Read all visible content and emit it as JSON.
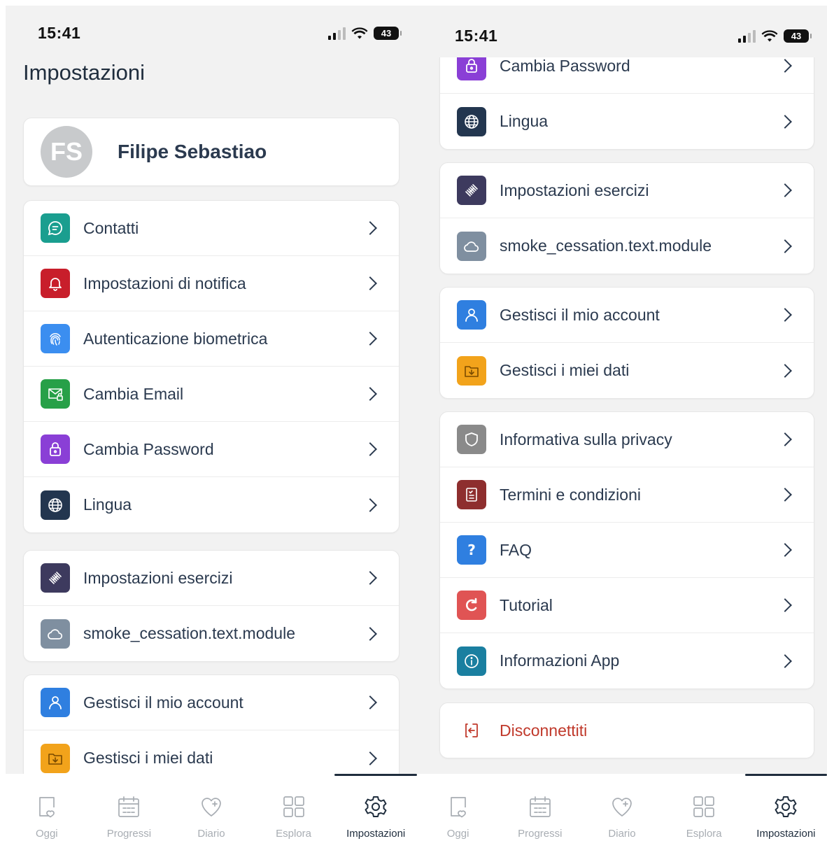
{
  "status": {
    "time": "15:41",
    "battery": "43"
  },
  "left": {
    "title": "Impostazioni",
    "profile": {
      "initials": "FS",
      "name": "Filipe Sebastiao"
    },
    "group1": [
      {
        "label": "Contatti",
        "icon": "chat-icon",
        "color": "#1a9e8f"
      },
      {
        "label": "Impostazioni di notifica",
        "icon": "bell-icon",
        "color": "#c81e2b"
      },
      {
        "label": "Autenticazione biometrica",
        "icon": "fingerprint-icon",
        "color": "#3b8ef0"
      },
      {
        "label": "Cambia Email",
        "icon": "mail-lock-icon",
        "color": "#27a048"
      },
      {
        "label": "Cambia Password",
        "icon": "lock-icon",
        "color": "#8a3fd6"
      },
      {
        "label": "Lingua",
        "icon": "globe-icon",
        "color": "#23364f"
      }
    ],
    "group2": [
      {
        "label": "Impostazioni esercizi",
        "icon": "dumbbell-icon",
        "color": "#3d3a5e"
      },
      {
        "label": "smoke_cessation.text.module",
        "icon": "cloud-icon",
        "color": "#7f8fa0"
      }
    ],
    "group3": [
      {
        "label": "Gestisci il mio account",
        "icon": "user-icon",
        "color": "#2f7fe0"
      },
      {
        "label": "Gestisci i miei dati",
        "icon": "folder-download-icon",
        "color": "#f2a31b"
      }
    ]
  },
  "right": {
    "group1": [
      {
        "label": "Cambia Password",
        "icon": "lock-icon",
        "color": "#8a3fd6"
      },
      {
        "label": "Lingua",
        "icon": "globe-icon",
        "color": "#23364f"
      }
    ],
    "group2": [
      {
        "label": "Impostazioni esercizi",
        "icon": "dumbbell-icon",
        "color": "#3d3a5e"
      },
      {
        "label": "smoke_cessation.text.module",
        "icon": "cloud-icon",
        "color": "#7f8fa0"
      }
    ],
    "group3": [
      {
        "label": "Gestisci il mio account",
        "icon": "user-icon",
        "color": "#2f7fe0"
      },
      {
        "label": "Gestisci i miei dati",
        "icon": "folder-download-icon",
        "color": "#f2a31b"
      }
    ],
    "group4": [
      {
        "label": "Informativa sulla privacy",
        "icon": "shield-icon",
        "color": "#8a8a8a"
      },
      {
        "label": "Termini e condizioni",
        "icon": "document-icon",
        "color": "#8e2e2e"
      },
      {
        "label": "FAQ",
        "icon": "question-icon",
        "color": "#2f7fe0"
      },
      {
        "label": "Tutorial",
        "icon": "refresh-icon",
        "color": "#e05454"
      },
      {
        "label": "Informazioni App",
        "icon": "info-icon",
        "color": "#1a7fa0"
      }
    ],
    "logout": {
      "label": "Disconnettiti",
      "icon": "logout-icon",
      "color": "#c0392b"
    }
  },
  "tabs": [
    {
      "label": "Oggi",
      "icon": "today-icon"
    },
    {
      "label": "Progressi",
      "icon": "calendar-icon"
    },
    {
      "label": "Diario",
      "icon": "heart-icon"
    },
    {
      "label": "Esplora",
      "icon": "grid-icon"
    },
    {
      "label": "Impostazioni",
      "icon": "gear-icon",
      "active": true
    }
  ]
}
